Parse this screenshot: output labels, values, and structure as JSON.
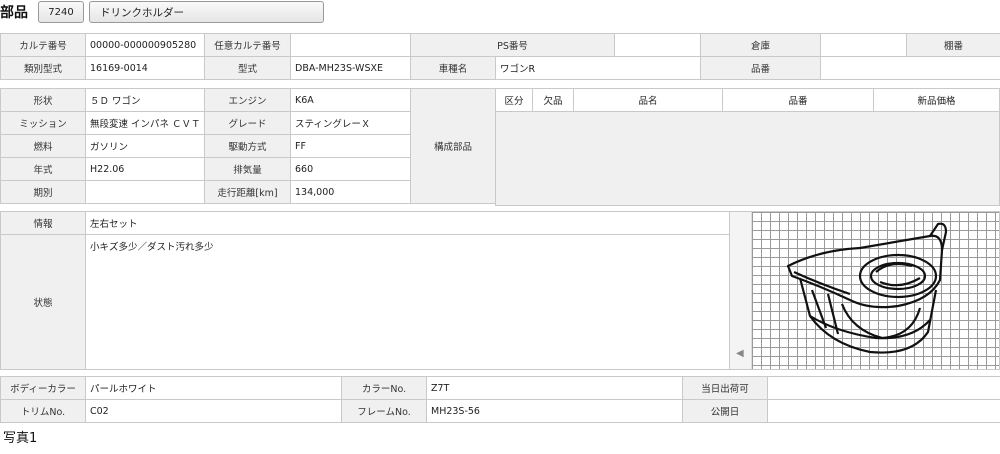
{
  "header": {
    "title": "部品",
    "part_code": "7240",
    "part_name": "ドリンクホルダー"
  },
  "top_table": {
    "row1": {
      "karte_label": "カルテ番号",
      "karte_value": "00000-000000905280",
      "opt_karte_label": "任意カルテ番号",
      "opt_karte_value": "",
      "ps_label": "PS番号",
      "ps_value": "",
      "warehouse_label": "倉庫",
      "warehouse_value": "",
      "shelf_label": "棚番",
      "shelf_value": ""
    },
    "row2": {
      "type_cat_label": "類別型式",
      "type_cat_value": "16169-0014",
      "model_label": "型式",
      "model_value": "DBA-MH23S-WSXE",
      "car_name_label": "車種名",
      "car_name_value": "ワゴンR",
      "part_no_label": "品番",
      "part_no_value": ""
    }
  },
  "vehicle": {
    "shape_label": "形状",
    "shape_value": "５Ｄ ワゴン",
    "engine_label": "エンジン",
    "engine_value": "K6A",
    "mission_label": "ミッション",
    "mission_value": "無段変速 インパネ ＣＶＴ",
    "grade_label": "グレード",
    "grade_value": "スティングレーＸ",
    "fuel_label": "燃料",
    "fuel_value": "ガソリン",
    "drive_label": "駆動方式",
    "drive_value": "FF",
    "year_label": "年式",
    "year_value": "H22.06",
    "displacement_label": "排気量",
    "displacement_value": "660",
    "period_label": "期別",
    "period_value": "",
    "mileage_label": "走行距離[km]",
    "mileage_value": "134,000",
    "components_label": "構成部品"
  },
  "parts_table": {
    "headers": [
      "区分",
      "欠品",
      "品名",
      "品番",
      "新品価格"
    ]
  },
  "info": {
    "info_label": "情報",
    "info_value": "左右セット",
    "condition_label": "状態",
    "condition_value": "小キズ多少／ダスト汚れ多少"
  },
  "bottom": {
    "body_color_label": "ボディーカラー",
    "body_color_value": "パールホワイト",
    "color_no_label": "カラーNo.",
    "color_no_value": "Z7T",
    "ship_label": "当日出荷可",
    "ship_value": "",
    "trim_label": "トリムNo.",
    "trim_value": "C02",
    "frame_label": "フレームNo.",
    "frame_value": "MH23S-56",
    "public_label": "公開日",
    "public_value": ""
  },
  "photo": {
    "caption": "写真1",
    "prev_icon": "chevron-left-icon"
  }
}
